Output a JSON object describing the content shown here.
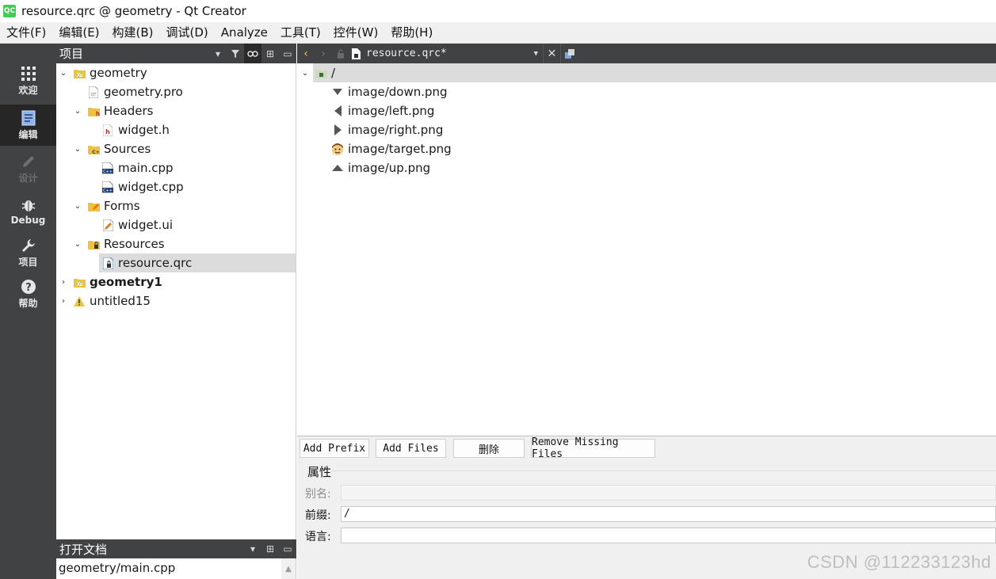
{
  "window": {
    "app_icon_text": "QC",
    "title": "resource.qrc @ geometry - Qt Creator"
  },
  "menu": [
    "文件(F)",
    "编辑(E)",
    "构建(B)",
    "调试(D)",
    "Analyze",
    "工具(T)",
    "控件(W)",
    "帮助(H)"
  ],
  "modes": [
    {
      "label": "欢迎",
      "icon": "grid-icon"
    },
    {
      "label": "编辑",
      "icon": "document-icon"
    },
    {
      "label": "设计",
      "icon": "pencil-icon"
    },
    {
      "label": "Debug",
      "icon": "bug-icon"
    },
    {
      "label": "项目",
      "icon": "wrench-icon"
    },
    {
      "label": "帮助",
      "icon": "help-icon"
    }
  ],
  "project_pane": {
    "title": "项目",
    "tree": [
      {
        "label": "geometry",
        "icon": "project-folder-icon"
      },
      {
        "label": "geometry.pro",
        "icon": "pro-file-icon"
      },
      {
        "label": "Headers",
        "icon": "headers-folder-icon"
      },
      {
        "label": "widget.h",
        "icon": "header-file-icon"
      },
      {
        "label": "Sources",
        "icon": "sources-folder-icon"
      },
      {
        "label": "main.cpp",
        "icon": "cpp-file-icon"
      },
      {
        "label": "widget.cpp",
        "icon": "cpp-file-icon"
      },
      {
        "label": "Forms",
        "icon": "forms-folder-icon"
      },
      {
        "label": "widget.ui",
        "icon": "ui-file-icon"
      },
      {
        "label": "Resources",
        "icon": "resources-folder-icon"
      },
      {
        "label": "resource.qrc",
        "icon": "qrc-file-icon"
      },
      {
        "label": "geometry1",
        "icon": "project-folder-icon"
      },
      {
        "label": "untitled15",
        "icon": "warning-icon"
      }
    ]
  },
  "open_docs": {
    "title": "打开文档",
    "items": [
      "geometry/main.cpp"
    ]
  },
  "editor": {
    "current_document": "resource.qrc*",
    "root_prefix": "/",
    "files": [
      {
        "label": "image/down.png",
        "icon": "down-triangle-icon"
      },
      {
        "label": "image/left.png",
        "icon": "left-triangle-icon"
      },
      {
        "label": "image/right.png",
        "icon": "right-triangle-icon"
      },
      {
        "label": "image/target.png",
        "icon": "face-icon"
      },
      {
        "label": "image/up.png",
        "icon": "up-triangle-icon"
      }
    ]
  },
  "buttons": {
    "add_prefix": "Add Prefix",
    "add_files": "Add Files",
    "delete": "删除",
    "remove_missing": "Remove Missing Files"
  },
  "properties": {
    "title": "属性",
    "alias_label": "别名:",
    "alias_value": "",
    "prefix_label": "前缀:",
    "prefix_value": "/",
    "language_label": "语言:",
    "language_value": ""
  },
  "watermark": "CSDN @112233123hd",
  "colors": {
    "sidebar": "#404244",
    "active_mode": "#262626",
    "selection": "#dcdcdc",
    "folder": "#f0c23b"
  }
}
